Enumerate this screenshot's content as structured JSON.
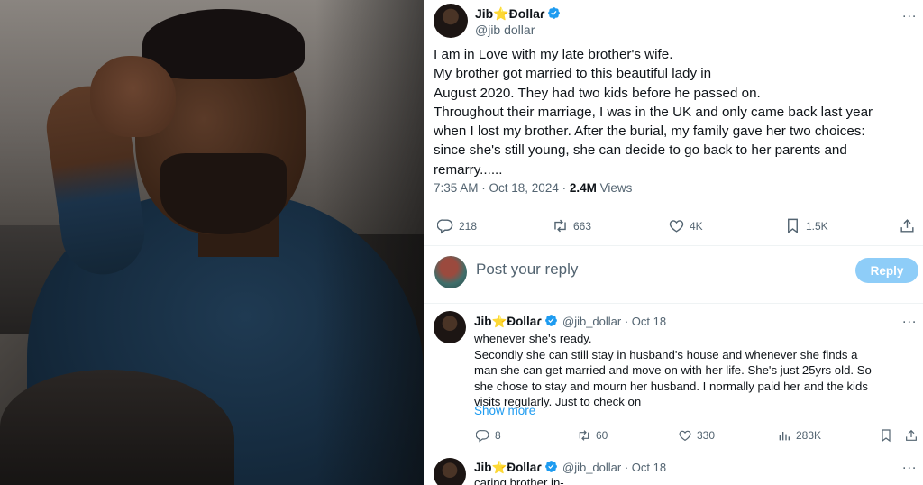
{
  "colors": {
    "accent": "#1d9bf0",
    "reply_button": "#8ecdf8",
    "muted": "#536471",
    "text": "#0f1419"
  },
  "photo": {
    "subject": "man-sitting-thoughtful"
  },
  "main_tweet": {
    "author_name": "Jib⭐Ðollaɾ",
    "author_handle": "@jib dollar",
    "verified_icon": "verified-badge-icon",
    "more_icon": "...",
    "lines": [
      "I am in Love with my late brother's wife.",
      "My brother got married to this beautiful lady in",
      "August 2020. They had two kids before he passed on.",
      "Throughout their marriage, I was in the UK and only came back last year",
      "when I lost my brother. After the burial, my family gave her two choices:",
      "since she's still young, she can decide to go back to her parents and",
      "remarry......"
    ],
    "time": "7:35 AM · Oct 18, 2024 · ",
    "views_count": "2.4M",
    "views_label": " Views",
    "actions": {
      "replies": "218",
      "reposts": "663",
      "likes": "4K",
      "bookmarks": "1.5K"
    }
  },
  "reply_box": {
    "placeholder": "Post your reply",
    "button": "Reply"
  },
  "reply_1": {
    "author_name": "Jib⭐Ðollaɾ",
    "author_handle": "@jib_dollar",
    "date": " · Oct 18",
    "more_icon": "...",
    "lines": [
      "whenever she's ready.",
      "Secondly she can still stay in husband's house and whenever she finds a",
      "man she can get married and move on with her life. She's just 25yrs old. So",
      "she chose to stay and mourn her husband. I normally paid her and the kids",
      "visits regularly. Just to check on"
    ],
    "show_more": "Show more",
    "actions": {
      "replies": "8",
      "reposts": "60",
      "likes": "330",
      "views": "283K"
    }
  },
  "reply_2": {
    "author_name": "Jib⭐Ðollaɾ",
    "author_handle": "@jib_dollar",
    "date": " · Oct 18",
    "more_icon": "...",
    "first_line": "caring brother in-"
  }
}
